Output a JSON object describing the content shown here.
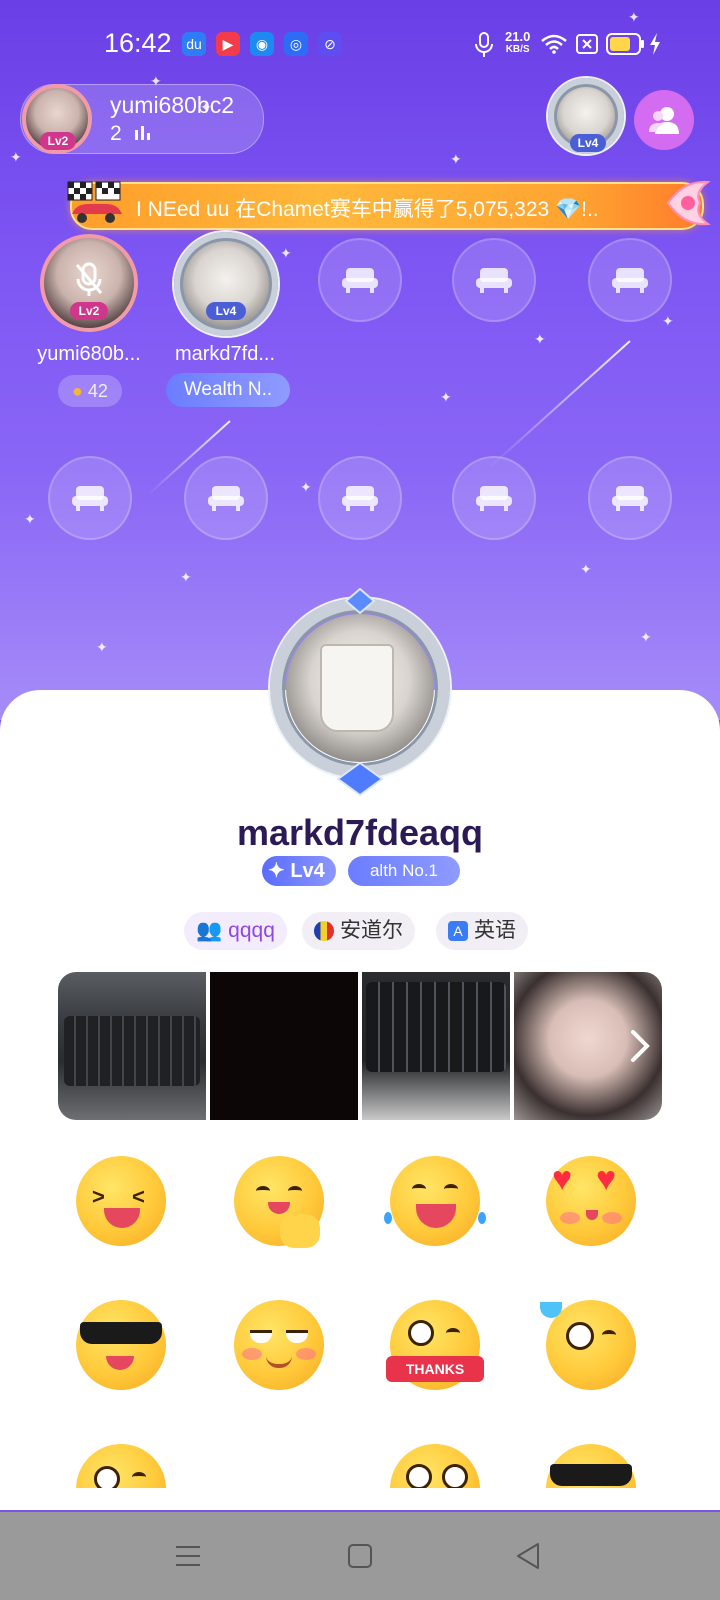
{
  "status_bar": {
    "time": "16:42",
    "net_speed_value": "21.0",
    "net_speed_unit": "KB/S",
    "app_icons": [
      "baidu-icon",
      "video-icon",
      "camera-app-icon",
      "browser-icon",
      "vpn-icon"
    ],
    "status_icons": [
      "microphone-icon",
      "wifi-icon",
      "sim-icon",
      "battery-icon",
      "charging-icon"
    ]
  },
  "host": {
    "name": "yumi680bc2",
    "count": "2",
    "level": "Lv2",
    "owner_level": "Lv4"
  },
  "banner": {
    "message": "I NEed uu 在Chamet赛车中赢得了5,075,323 💎!.."
  },
  "seats": {
    "seat1_name": "yumi680b...",
    "seat1_level": "Lv2",
    "seat1_coins": "42",
    "seat2_name": "markd7fd...",
    "seat2_level": "Lv4",
    "seat2_badge": "Wealth N.."
  },
  "profile": {
    "username": "markd7fdeaqq",
    "level": "Lv4",
    "wealth_badge": "alth No.1",
    "tags": [
      {
        "icon": "group-icon",
        "label": "qqqq"
      },
      {
        "icon": "andorra-flag-icon",
        "label": "安道尔"
      },
      {
        "icon": "language-icon",
        "label": "英语"
      }
    ]
  },
  "colors": {
    "bg_top": "#6a3fe6",
    "accent_purple": "#7c4dff",
    "banner_orange": "#ffa431",
    "level_blue": "#5a6cff"
  }
}
